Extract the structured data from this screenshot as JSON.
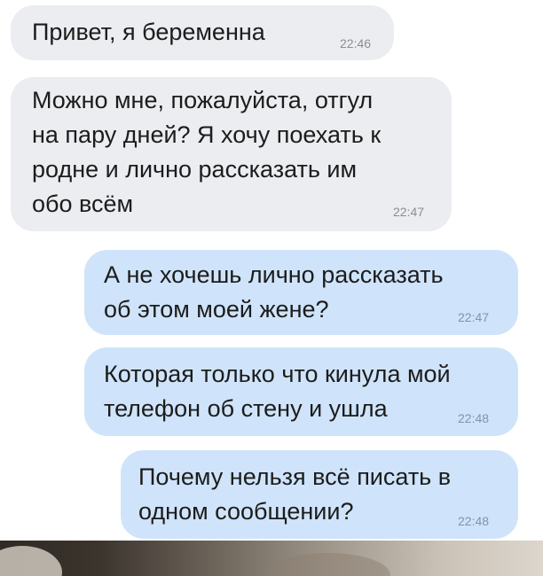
{
  "messages": [
    {
      "direction": "incoming",
      "text": "Привет, я беременна",
      "time": "22:46"
    },
    {
      "direction": "incoming",
      "text": "Можно мне, пожалуйста, отгул\nна пару дней? Я хочу поехать к\nродне и лично рассказать им\nобо всём",
      "time": "22:47"
    },
    {
      "direction": "outgoing",
      "text": "А не хочешь лично рассказать\nоб этом моей жене?",
      "time": "22:47"
    },
    {
      "direction": "outgoing",
      "text": "Которая только что кинула мой\nтелефон об стену и ушла",
      "time": "22:48"
    },
    {
      "direction": "outgoing",
      "text": "Почему нельзя всё писать в\nодном сообщении?",
      "time": "22:48"
    }
  ],
  "colors": {
    "incoming_bubble": "#ebedf0",
    "outgoing_bubble": "#cfe4fa",
    "text": "#1c1c1c",
    "timestamp": "#8a8f96"
  }
}
